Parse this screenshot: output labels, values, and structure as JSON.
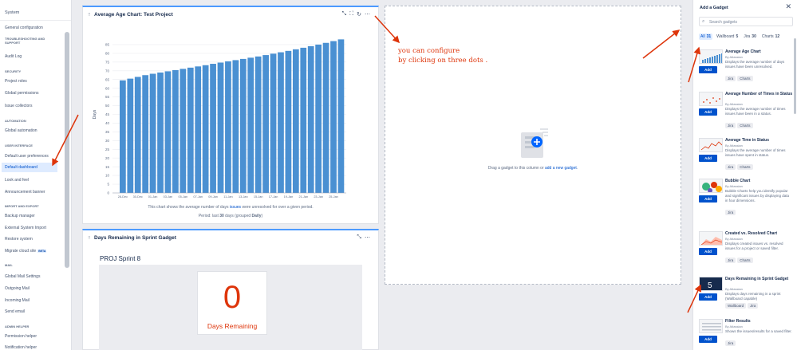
{
  "sidebar": {
    "title": "System",
    "items": [
      {
        "label": "General configuration",
        "type": "item"
      },
      {
        "label": "TROUBLESHOOTING AND SUPPORT",
        "type": "section"
      },
      {
        "label": "Audit Log",
        "type": "item"
      },
      {
        "label": "SECURITY",
        "type": "section"
      },
      {
        "label": "Project roles",
        "type": "item"
      },
      {
        "label": "Global permissions",
        "type": "item"
      },
      {
        "label": "Issue collectors",
        "type": "item"
      },
      {
        "label": "AUTOMATION",
        "type": "section"
      },
      {
        "label": "Global automation",
        "type": "item"
      },
      {
        "label": "USER INTERFACE",
        "type": "section"
      },
      {
        "label": "Default user preferences",
        "type": "item"
      },
      {
        "label": "Default dashboard",
        "type": "active"
      },
      {
        "label": "Look and feel",
        "type": "item"
      },
      {
        "label": "Announcement banner",
        "type": "item"
      },
      {
        "label": "IMPORT AND EXPORT",
        "type": "section"
      },
      {
        "label": "Backup manager",
        "type": "item"
      },
      {
        "label": "External System Import",
        "type": "item"
      },
      {
        "label": "Restore system",
        "type": "item"
      },
      {
        "label": "Migrate cloud site",
        "type": "item",
        "badge": "BETA"
      },
      {
        "label": "MAIL",
        "type": "section"
      },
      {
        "label": "Global Mail Settings",
        "type": "item"
      },
      {
        "label": "Outgoing Mail",
        "type": "item"
      },
      {
        "label": "Incoming Mail",
        "type": "item"
      },
      {
        "label": "Send email",
        "type": "item"
      },
      {
        "label": "ADMIN HELPER",
        "type": "section"
      },
      {
        "label": "Permission helper",
        "type": "item"
      },
      {
        "label": "Notification helper",
        "type": "item"
      }
    ]
  },
  "age_gadget": {
    "title": "Average Age Chart: Test Project",
    "caption_before": "This chart shows the average number of days ",
    "caption_link": "issues",
    "caption_after": " were unresolved for over a given period.",
    "period_prefix": "Period: last ",
    "period_days": "30",
    "period_mid": " days (grouped ",
    "period_group": "Daily",
    "period_suffix": ")"
  },
  "chart_data": {
    "type": "bar",
    "title": "",
    "xlabel": "",
    "ylabel": "Days",
    "ylim": [
      0,
      90
    ],
    "yticks": [
      0,
      5,
      10,
      15,
      20,
      25,
      30,
      35,
      40,
      45,
      50,
      55,
      60,
      65,
      70,
      75,
      80,
      85
    ],
    "x_tick_labels": [
      "28-Dec",
      "30-Dec",
      "01-Jan",
      "03-Jan",
      "05-Jan",
      "07-Jan",
      "09-Jan",
      "11-Jan",
      "13-Jan",
      "15-Jan",
      "17-Jan",
      "19-Jan",
      "21-Jan",
      "23-Jan",
      "25-Jan"
    ],
    "categories": [
      "1",
      "2",
      "3",
      "4",
      "5",
      "6",
      "7",
      "8",
      "9",
      "10",
      "11",
      "12",
      "13",
      "14",
      "15",
      "16",
      "17",
      "18",
      "19",
      "20",
      "21",
      "22",
      "23",
      "24",
      "25",
      "26",
      "27",
      "28",
      "29",
      "30"
    ],
    "values": [
      64.5,
      65.5,
      66.5,
      67.5,
      68.3,
      69,
      69.7,
      70.4,
      71.1,
      71.8,
      72.5,
      73.2,
      74,
      74.7,
      75.4,
      76.1,
      76.8,
      77.5,
      78.2,
      79,
      79.8,
      80.6,
      81.4,
      82.3,
      83.2,
      84.1,
      85,
      86,
      87,
      88
    ],
    "bar_color": "#4a90d2",
    "grid": true
  },
  "dropzone": {
    "text_before": "Drag a gadget to this column or ",
    "link": "add a new gadget",
    "text_after": "."
  },
  "annotation": {
    "text": "you can configure\nby clicking on three dots ."
  },
  "sprint_gadget": {
    "title": "Days Remaining in Sprint Gadget",
    "sprint_name": "PROJ Sprint 8",
    "days_value": "0",
    "days_label": "Days Remaining"
  },
  "add_gadget": {
    "title": "Add a Gadget",
    "search_placeholder": "Search gadgets",
    "tabs": [
      {
        "label": "All",
        "count": "31",
        "active": true
      },
      {
        "label": "Wallboard",
        "count": "5"
      },
      {
        "label": "Jira",
        "count": "30"
      },
      {
        "label": "Charts",
        "count": "12"
      }
    ],
    "add_label": "Add",
    "gadgets": [
      {
        "title": "Average Age Chart",
        "by": "By Atlassian",
        "desc": "Displays the average number of days issues have been unresolved.",
        "tags": [
          "Jira",
          "Charts"
        ],
        "thumb": "bars"
      },
      {
        "title": "Average Number of Times in Status",
        "by": "By Atlassian",
        "desc": "Displays the average number of times issues have been in a status.",
        "tags": [
          "Jira",
          "Charts"
        ],
        "thumb": "dots-red"
      },
      {
        "title": "Average Time in Status",
        "by": "By Atlassian",
        "desc": "Displays the average number of times issues have spent in status.",
        "tags": [
          "Jira",
          "Charts"
        ],
        "thumb": "line-red"
      },
      {
        "title": "Bubble Chart",
        "by": "By Atlassian",
        "desc": "Bubble Charts help you identify popular and significant issues by displaying data in four dimensions.",
        "tags": [
          "Jira"
        ],
        "thumb": "bubbles"
      },
      {
        "title": "Created vs. Resolved Chart",
        "by": "By Atlassian",
        "desc": "Displays created issues vs. resolved issues for a project or saved filter.",
        "tags": [
          "Jira",
          "Charts"
        ],
        "thumb": "area"
      },
      {
        "title": "Days Remaining in Sprint Gadget",
        "by": "By Atlassian",
        "desc": "Displays days remaining in a sprint (Wallboard capable)",
        "tags": [
          "Wallboard",
          "Jira"
        ],
        "thumb": "dark"
      },
      {
        "title": "Filter Results",
        "by": "By Atlassian",
        "desc": "Shows the issues/results for a saved filter.",
        "tags": [
          "Jira"
        ],
        "thumb": "list"
      }
    ]
  }
}
